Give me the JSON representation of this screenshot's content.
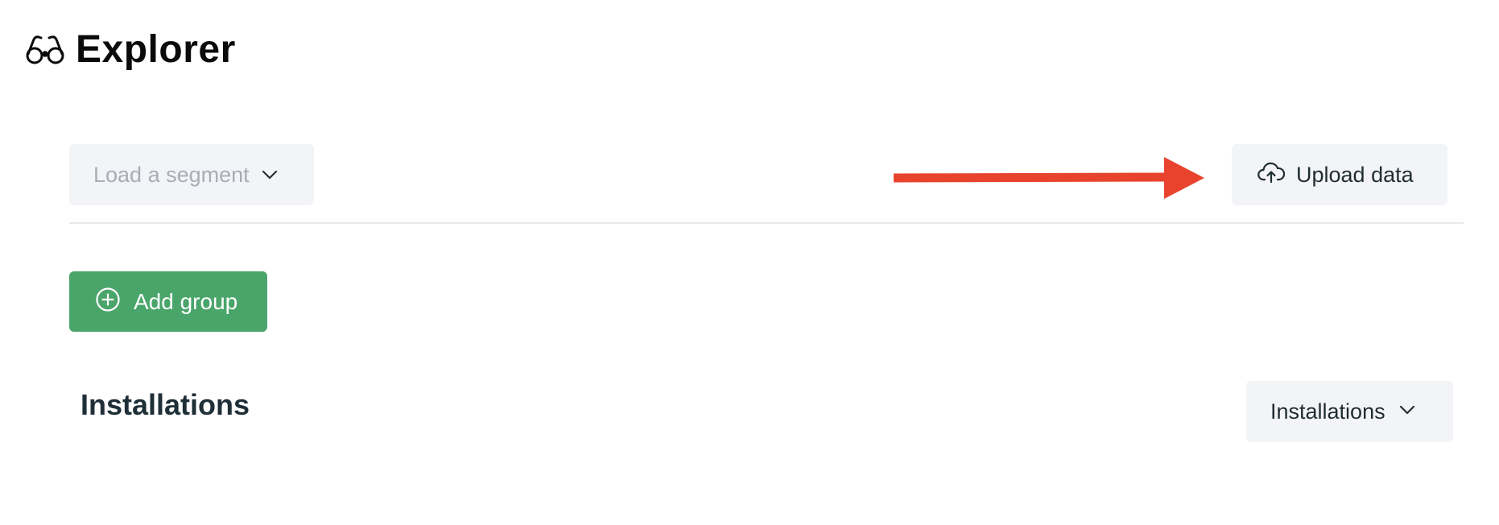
{
  "header": {
    "title": "Explorer",
    "icon": "binoculars-icon"
  },
  "toolbar": {
    "segment_select": {
      "placeholder": "Load a segment",
      "icon": "chevron-down-icon"
    },
    "upload_button": {
      "label": "Upload data",
      "icon": "cloud-upload-icon"
    },
    "annotation": {
      "type": "arrow",
      "color": "#e8432d"
    }
  },
  "actions": {
    "add_group": {
      "label": "Add group",
      "icon": "plus-circle-icon",
      "color": "#4aa56a"
    }
  },
  "section": {
    "title": "Installations",
    "metric_select": {
      "value": "Installations",
      "icon": "chevron-down-icon"
    }
  }
}
